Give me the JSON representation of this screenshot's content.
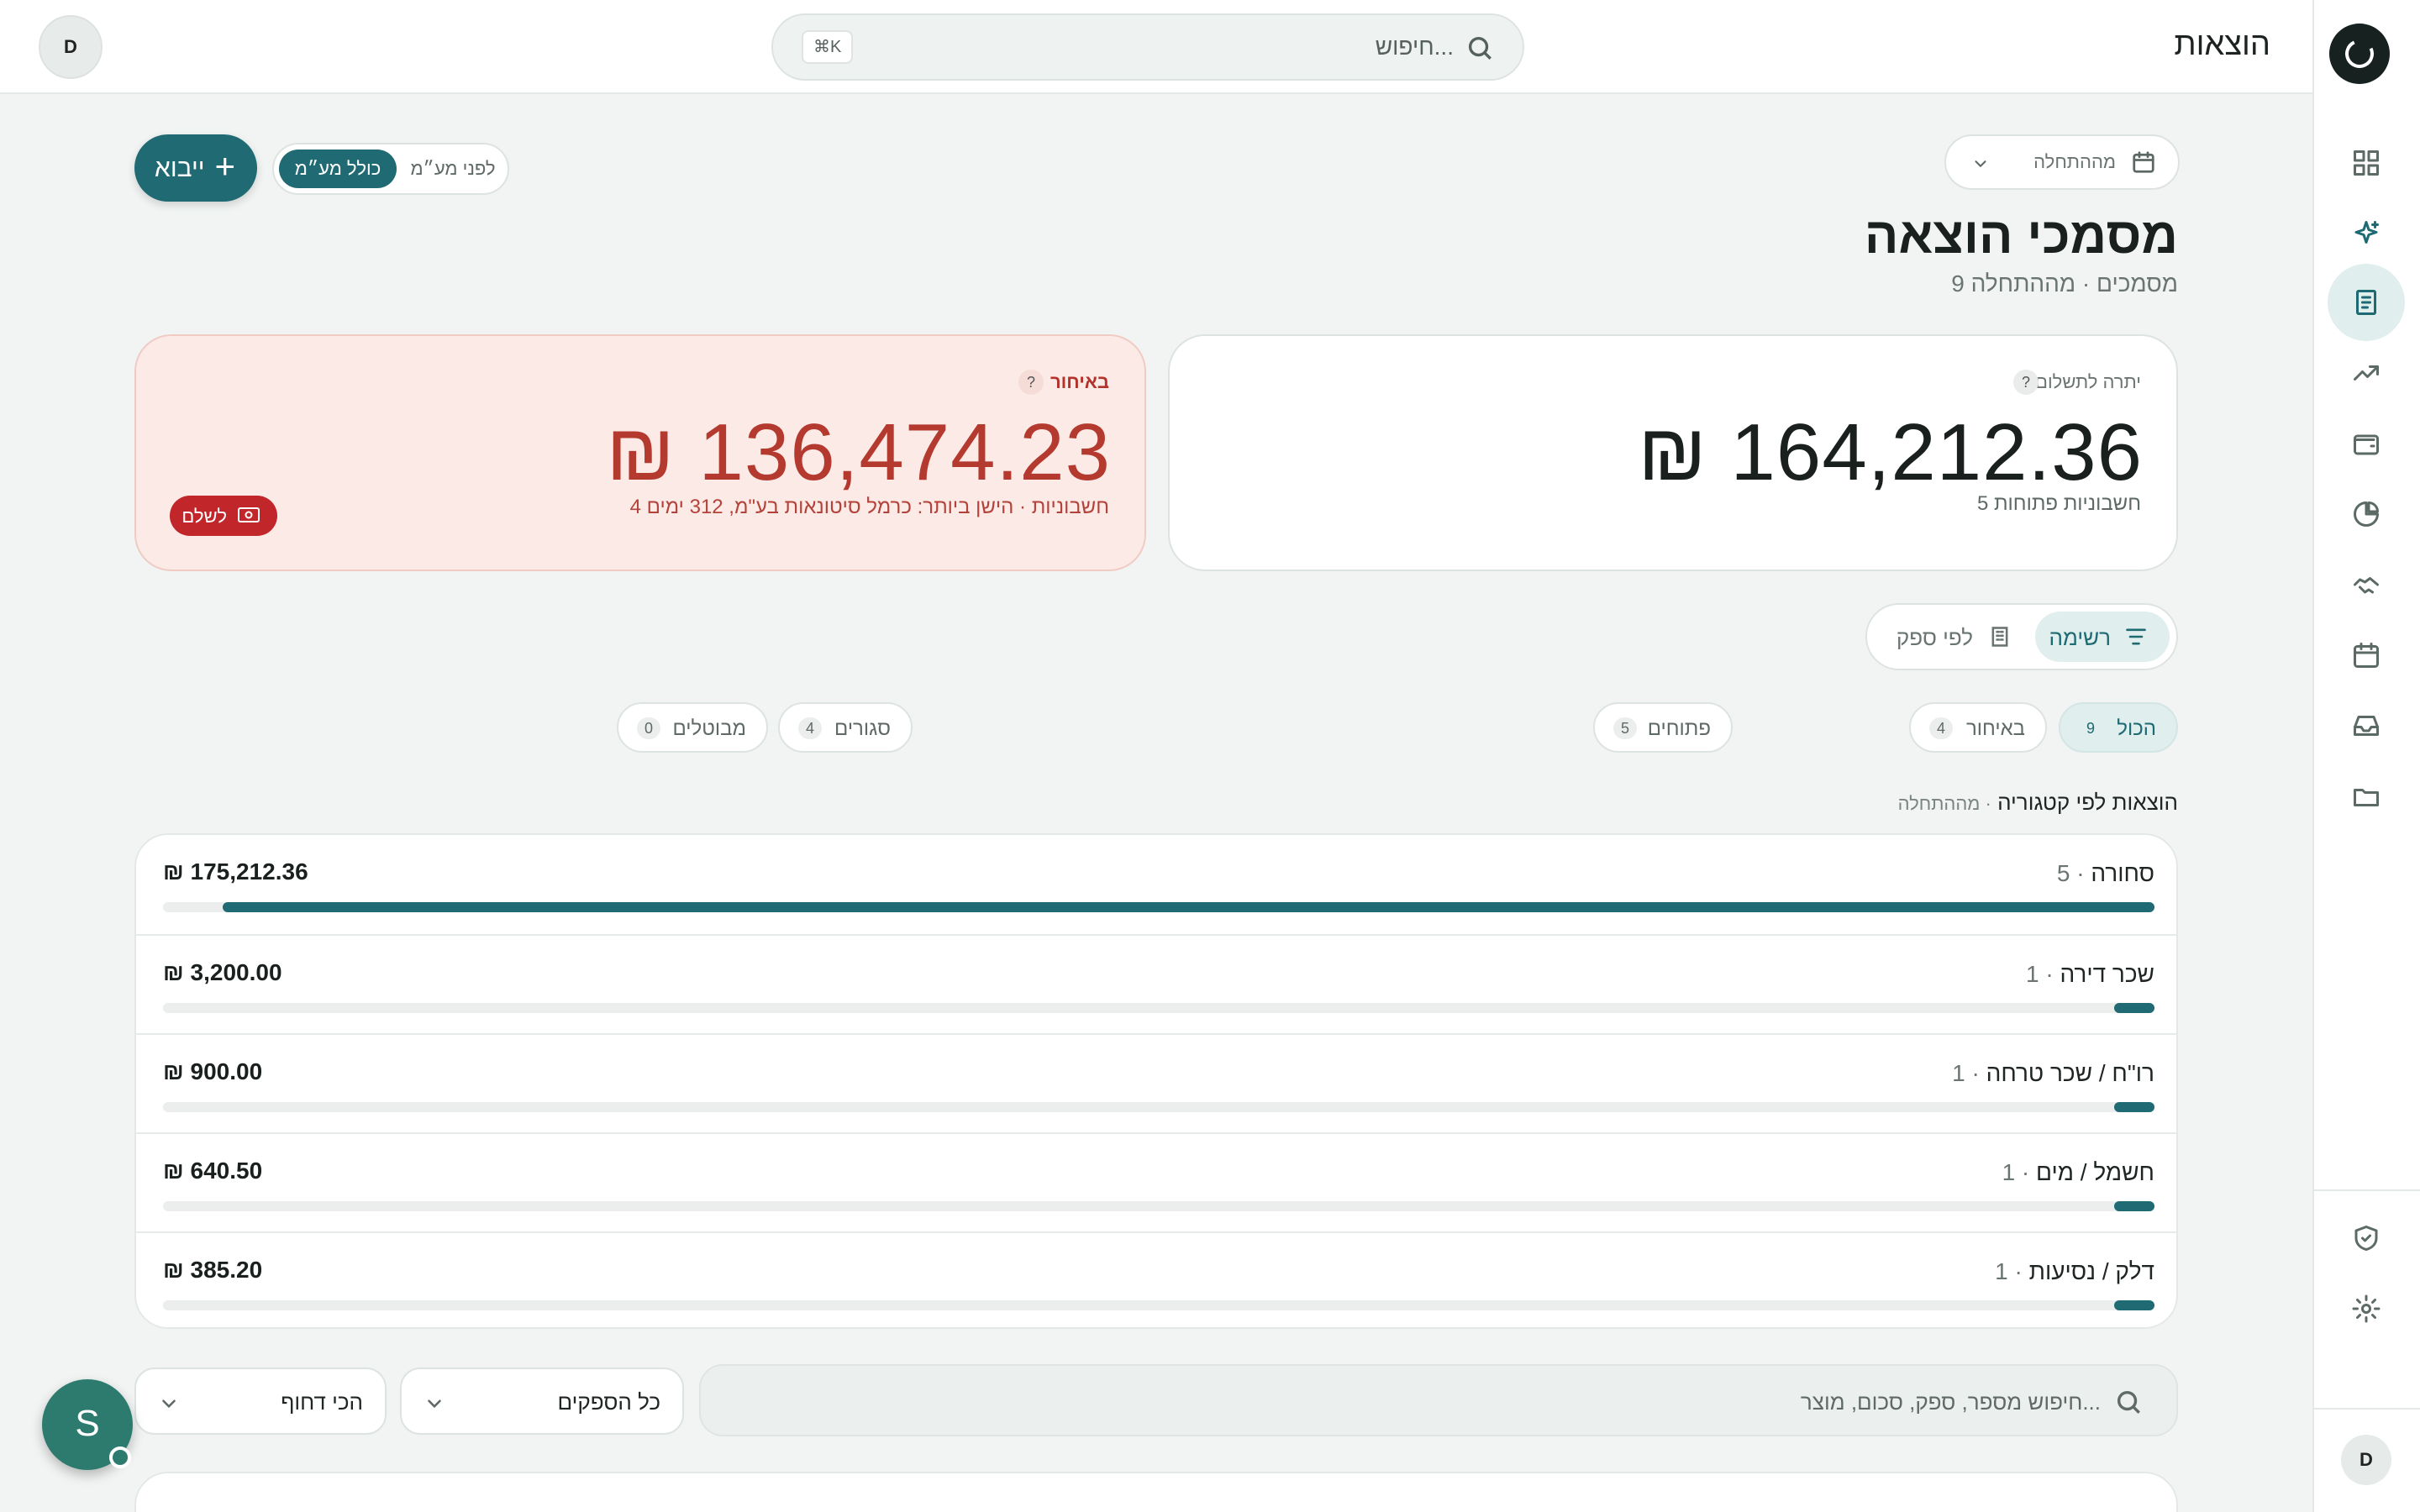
{
  "app": {
    "title": "הוצאות",
    "search_placeholder": "חיפוש...",
    "shortcut": "⌘K",
    "user_initial": "D"
  },
  "sidebar": {
    "items": [
      {
        "icon": "dashboard-icon",
        "active": false
      },
      {
        "icon": "sparkles-icon",
        "active": false
      },
      {
        "icon": "receipt-icon",
        "active": true
      },
      {
        "icon": "trending-up-icon",
        "active": false
      },
      {
        "icon": "wallet-icon",
        "active": false
      },
      {
        "icon": "pie-chart-icon",
        "active": false
      },
      {
        "icon": "handshake-icon",
        "active": false
      },
      {
        "icon": "calendar-icon",
        "active": false
      },
      {
        "icon": "inbox-icon",
        "active": false
      },
      {
        "icon": "folder-icon",
        "active": false
      }
    ],
    "bottom_items": [
      {
        "icon": "shield-check-icon"
      },
      {
        "icon": "gear-icon"
      }
    ],
    "user_initial": "D"
  },
  "header": {
    "date_filter": "מההתחלה",
    "title": "מסמכי הוצאה",
    "subtitle": "9 מסמכים · מההתחלה",
    "import_label": "ייבוא",
    "vat_toggle": {
      "included": "כולל מע״מ",
      "before": "לפני מע״מ"
    }
  },
  "kpis": {
    "balance": {
      "label": "יתרה לתשלום",
      "help": "?",
      "amount": "₪ 164,212.36",
      "note": "5 חשבוניות פתוחות"
    },
    "late": {
      "label": "באיחור",
      "help": "?",
      "amount": "₪ 136,474.23",
      "note": "4 חשבוניות · הישן ביותר: כרמל סיטונאות בע\"מ, 312 ימים",
      "pay_label": "לשלם"
    }
  },
  "view_switch": {
    "list": "רשימה",
    "by_vendor": "לפי ספק"
  },
  "status_chips": [
    {
      "label": "הכול",
      "count": "9",
      "active": true
    },
    {
      "label": "באיחור",
      "count": "4",
      "active": false
    },
    {
      "label": "פתוחים",
      "count": "5",
      "active": false
    },
    {
      "label": "סגורים",
      "count": "4",
      "active": false
    },
    {
      "label": "מבוטלים",
      "count": "0",
      "active": false
    }
  ],
  "categories": {
    "heading": "הוצאות לפי קטגוריה",
    "heading_sub": "· מההתחלה",
    "rows": [
      {
        "name": "סחורה",
        "count": "· 5",
        "amount": "₪ 175,212.36",
        "share": 0.97
      },
      {
        "name": "שכר דירה",
        "count": "· 1",
        "amount": "₪ 3,200.00",
        "share": 0.018
      },
      {
        "name": "רו\"ח / שכר טרחה",
        "count": "· 1",
        "amount": "₪ 900.00",
        "share": 0.005
      },
      {
        "name": "חשמל / מים",
        "count": "· 1",
        "amount": "₪ 640.50",
        "share": 0.004
      },
      {
        "name": "דלק / נסיעות",
        "count": "· 1",
        "amount": "₪ 385.20",
        "share": 0.002
      }
    ]
  },
  "filters": {
    "search_placeholder": "חיפוש מספר, ספק, סכום, מוצר...",
    "vendor_select": "כל הספקים",
    "sort_select": "הכי דחוף"
  },
  "assistant": {
    "initial": "S"
  },
  "colors": {
    "accent": "#1f6a73",
    "danger": "#c0262a",
    "late_bg": "#fceae7",
    "page_bg": "#f1f4f2"
  }
}
